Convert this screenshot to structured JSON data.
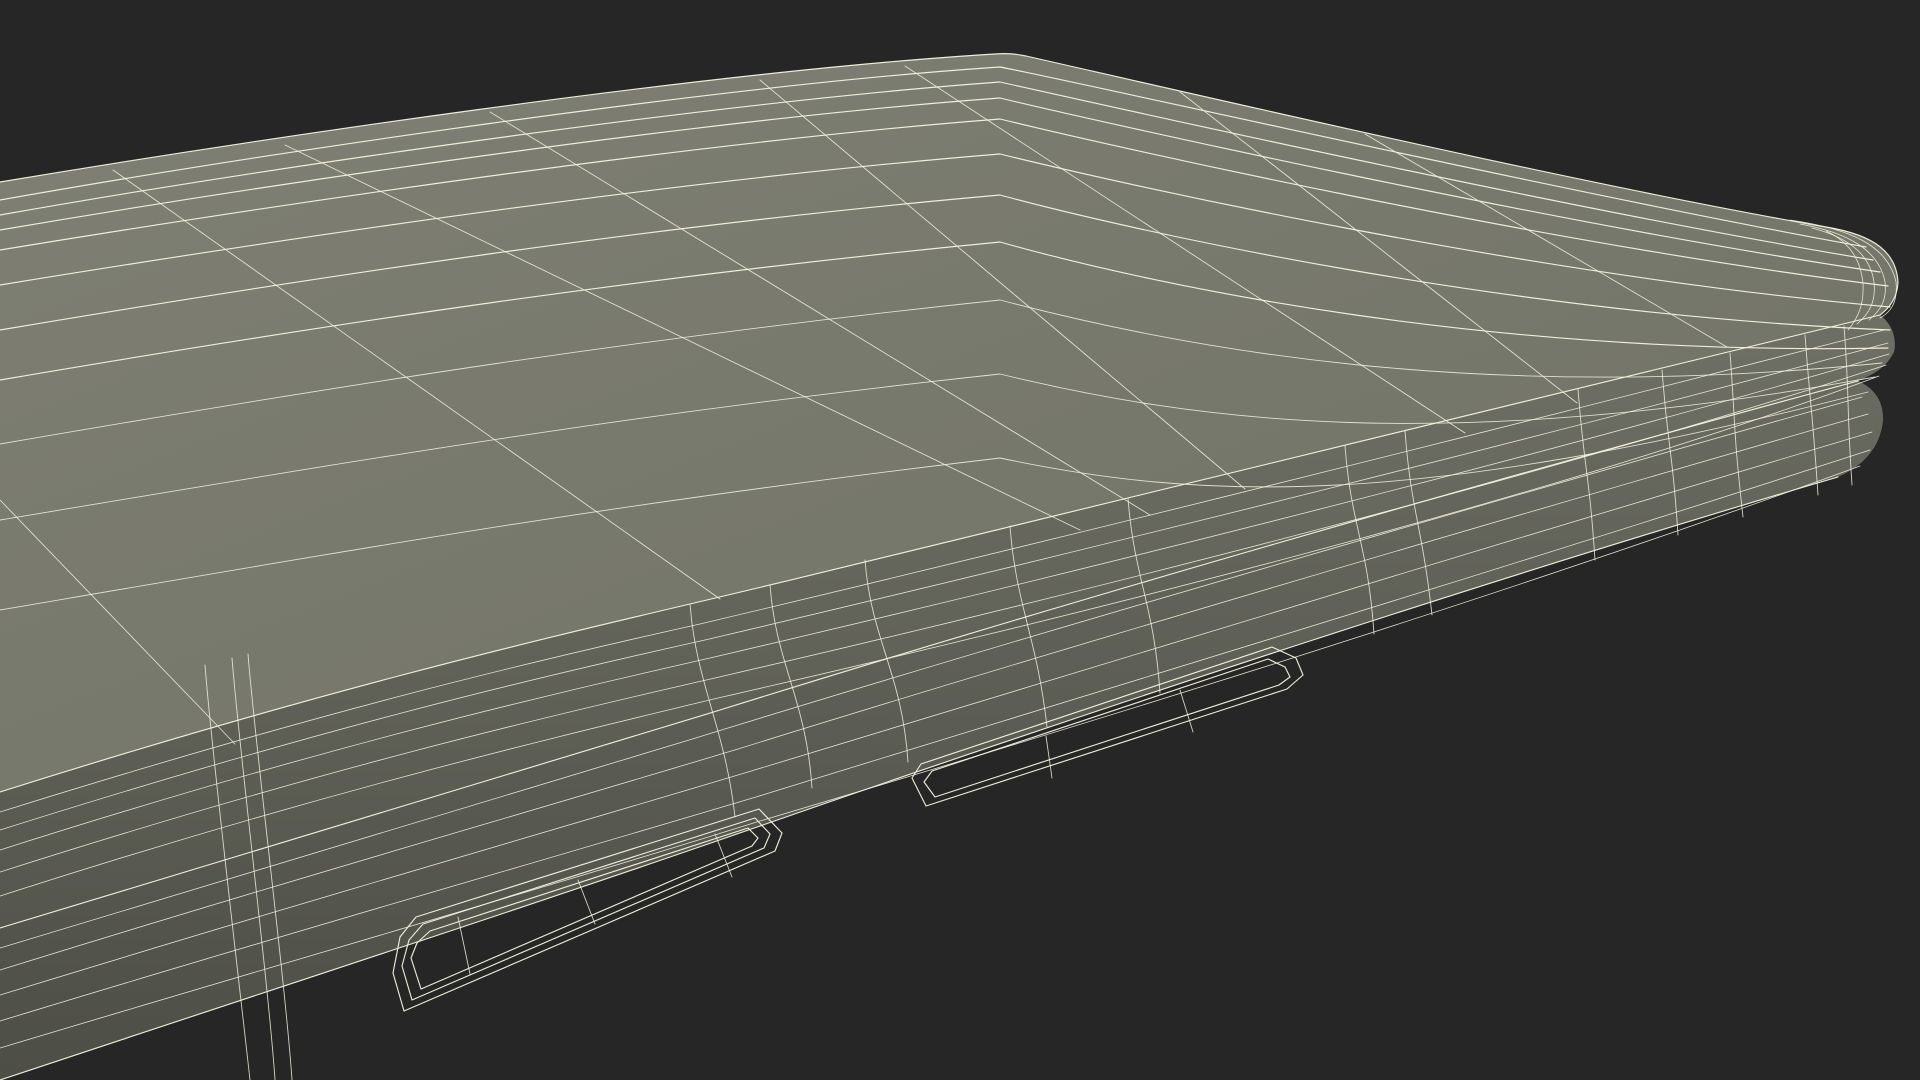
{
  "scene": {
    "subject": "wireframe-3d-device",
    "background_color": "#262626",
    "surface_color": "#797a6e",
    "shade_color": "#626358",
    "deep_shade_color": "#4f5047",
    "wire_color": "#f4f2de"
  }
}
